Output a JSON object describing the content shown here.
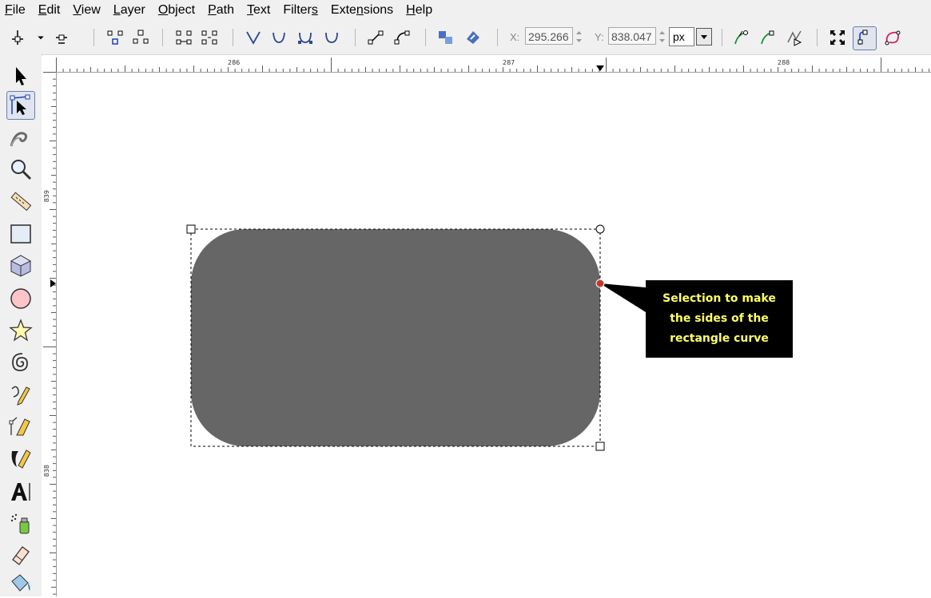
{
  "menubar": {
    "items": [
      {
        "label": "File",
        "mnemonic": "F",
        "rest": "ile"
      },
      {
        "label": "Edit",
        "mnemonic": "E",
        "rest": "dit"
      },
      {
        "label": "View",
        "mnemonic": "V",
        "rest": "iew"
      },
      {
        "label": "Layer",
        "mnemonic": "L",
        "rest": "ayer"
      },
      {
        "label": "Object",
        "mnemonic": "O",
        "rest": "bject"
      },
      {
        "label": "Path",
        "mnemonic": "P",
        "rest": "ath"
      },
      {
        "label": "Text",
        "mnemonic": "T",
        "rest": "ext"
      },
      {
        "label": "Filters",
        "pre": "Filter",
        "mnemonic": "s",
        "rest": ""
      },
      {
        "label": "Extensions",
        "pre": "Exte",
        "mnemonic": "n",
        "rest": "sions"
      },
      {
        "label": "Help",
        "mnemonic": "H",
        "rest": "elp"
      }
    ]
  },
  "toolbar": {
    "x_label": "X:",
    "x_value": "295.266",
    "y_label": "Y:",
    "y_value": "838.047",
    "unit": "px"
  },
  "ruler": {
    "h_labels": [
      "286",
      "287",
      "288"
    ],
    "v_labels": [
      "839",
      "838"
    ]
  },
  "callout": {
    "text": "Selection to make the sides of the rectangle curve"
  },
  "colors": {
    "shape_fill": "#666666",
    "callout_bg": "#000000",
    "callout_text": "#ffff66",
    "node_marker": "#c0392b"
  }
}
